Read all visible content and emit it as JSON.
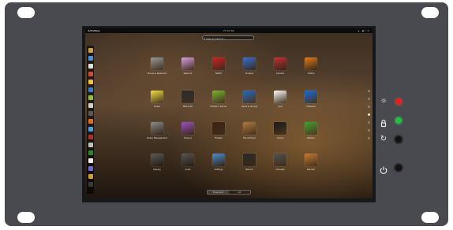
{
  "topbar": {
    "activities": "Activities",
    "clock": "Fri 07:04",
    "system": "▴ ◀) ⏻"
  },
  "search": {
    "placeholder": "Type to search..."
  },
  "apps": [
    {
      "label": "Mouse & Keyboard",
      "color": "#9a9a9a"
    },
    {
      "label": "Network",
      "color": "#d9a0e0"
    },
    {
      "label": "Netflix",
      "color": "#d12020"
    },
    {
      "label": "Screens",
      "color": "#3a6fd0"
    },
    {
      "label": "Camera",
      "color": "#c83030"
    },
    {
      "label": "Firefox",
      "color": "#e87a1a"
    },
    {
      "label": "Notes",
      "color": "#f0e040"
    },
    {
      "label": "Web Cam",
      "color": "#2a2a2a"
    },
    {
      "label": "NVIDIA X Server",
      "color": "#78b82a"
    },
    {
      "label": "Users & Groups",
      "color": "#2a6ac0"
    },
    {
      "label": "Java",
      "color": "#ffffff"
    },
    {
      "label": "Software",
      "color": "#1a6ad8"
    },
    {
      "label": "Power Management",
      "color": "#8a8a8a"
    },
    {
      "label": "Science",
      "color": "#a050c0"
    },
    {
      "label": "Theater",
      "color": "#402010"
    },
    {
      "label": "File Archiver",
      "color": "#b07a40"
    },
    {
      "label": "Oracle",
      "color": "#1a1a1a"
    },
    {
      "label": "Battery",
      "color": "#40a030"
    },
    {
      "label": "Display",
      "color": "#5a5a5a"
    },
    {
      "label": "Audio",
      "color": "#555555"
    },
    {
      "label": "Settings",
      "color": "#4a8ad0"
    },
    {
      "label": "Wacom",
      "color": "#2a2a2a"
    },
    {
      "label": "Inkscape",
      "color": "#505050"
    },
    {
      "label": "Blender",
      "color": "#c87a30"
    }
  ],
  "bottom_tabs": [
    "Frequent",
    "All"
  ],
  "dash_colors": [
    "#c9a050",
    "#4a90d9",
    "#e0e0e0",
    "#d04a3a",
    "#f0c040",
    "#3a7ad0",
    "#8ac040",
    "#d0d0d0",
    "#5a5a5a",
    "#e07020",
    "#4aa0e0",
    "#aa3030",
    "#c0c0c0",
    "#2a8a2a",
    "#f0f0f0",
    "#6a6ad0",
    "#d0a030",
    "#3a3a3a"
  ],
  "controls": {
    "brightness_icon": "brightness-icon",
    "lock_icon": "lock-icon",
    "rotate_icon": "rotate-icon",
    "power_icon": "power-icon",
    "led_red": "#e02020",
    "led_green": "#22c040"
  }
}
